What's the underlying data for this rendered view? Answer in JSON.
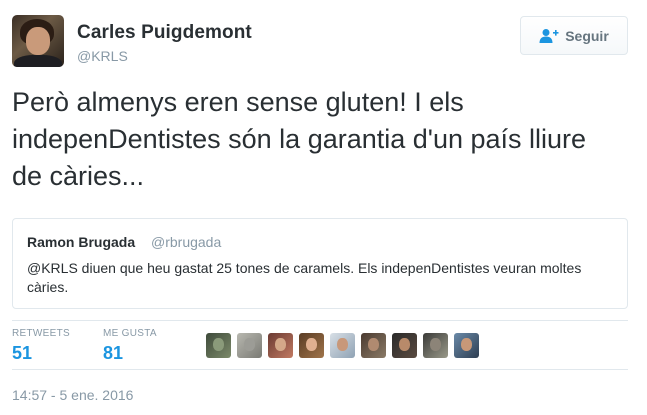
{
  "author": {
    "name": "Carles Puigdemont",
    "handle": "@KRLS"
  },
  "follow_button": {
    "label": "Seguir",
    "icon": "person-add-icon"
  },
  "tweet": {
    "text": "Però almenys eren sense gluten! I els indepenDentistes són la garantia d'un país lliure de càries..."
  },
  "quoted_tweet": {
    "name": "Ramon Brugada",
    "handle": "@rbrugada",
    "text": "@KRLS diuen que heu gastat 25 tones de caramels. Els indepenDentistes veuran moltes càries."
  },
  "stats": {
    "retweets_label": "RETWEETS",
    "retweets_value": "51",
    "likes_label": "ME GUSTA",
    "likes_value": "81"
  },
  "liker_avatars": [
    {
      "name": "liker-avatar-1"
    },
    {
      "name": "liker-avatar-2"
    },
    {
      "name": "liker-avatar-3"
    },
    {
      "name": "liker-avatar-4"
    },
    {
      "name": "liker-avatar-5"
    },
    {
      "name": "liker-avatar-6"
    },
    {
      "name": "liker-avatar-7"
    },
    {
      "name": "liker-avatar-8"
    },
    {
      "name": "liker-avatar-9"
    }
  ],
  "timestamp": "14:57 - 5 ene. 2016",
  "colors": {
    "accent": "#1b95e0",
    "muted": "#8899a6",
    "text": "#292f33",
    "border": "#e1e8ed"
  }
}
